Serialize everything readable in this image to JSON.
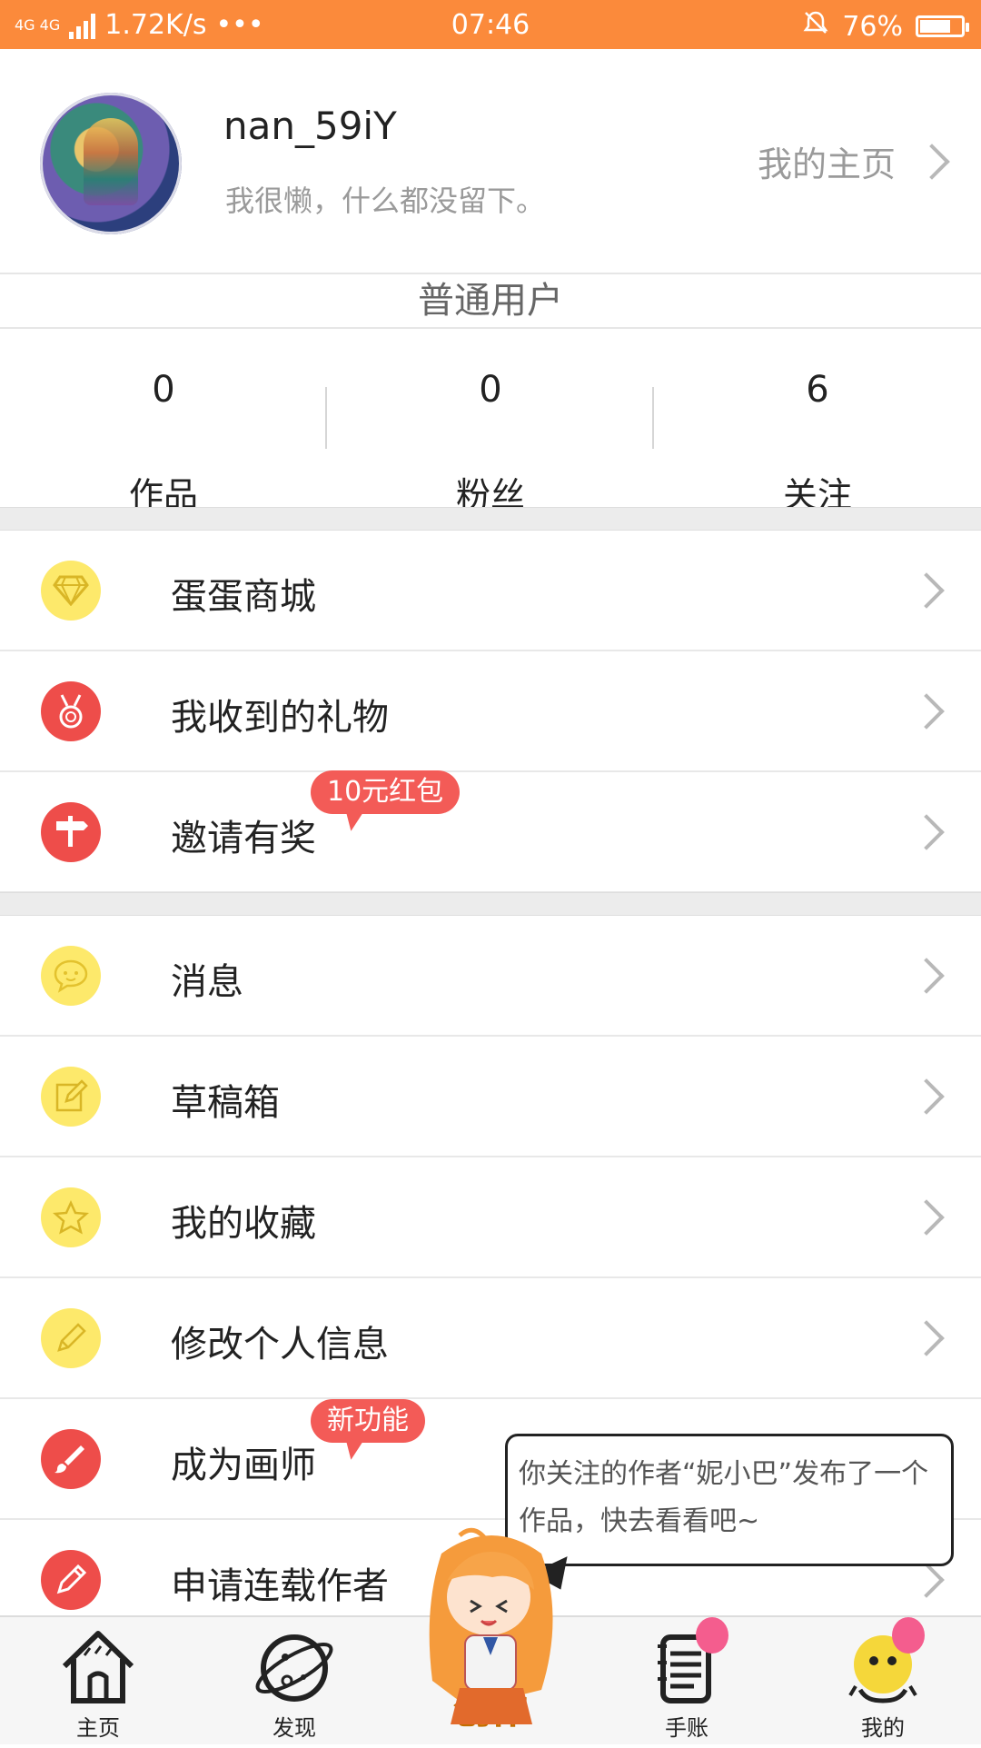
{
  "status_bar": {
    "network": "4G 4G",
    "speed": "1.72K/s",
    "dots": "•••",
    "time": "07:46",
    "battery_text": "76%",
    "battery_level": 0.76
  },
  "profile": {
    "username": "nan_59iY",
    "signature": "我很懒，什么都没留下。",
    "homepage_label": "我的主页",
    "user_level": "普通用户"
  },
  "stats": [
    {
      "value": "0",
      "label": "作品"
    },
    {
      "value": "0",
      "label": "粉丝"
    },
    {
      "value": "6",
      "label": "关注"
    }
  ],
  "menu_group1": [
    {
      "label": "蛋蛋商城",
      "icon": "diamond-icon",
      "color": "yellow"
    },
    {
      "label": "我收到的礼物",
      "icon": "medal-icon",
      "color": "red"
    },
    {
      "label": "邀请有奖",
      "icon": "signpost-icon",
      "color": "red",
      "badge": "10元红包"
    }
  ],
  "menu_group2": [
    {
      "label": "消息",
      "icon": "chat-face-icon",
      "color": "yellow"
    },
    {
      "label": "草稿箱",
      "icon": "edit-icon",
      "color": "yellow"
    },
    {
      "label": "我的收藏",
      "icon": "star-icon",
      "color": "yellow"
    },
    {
      "label": "修改个人信息",
      "icon": "pencil-icon",
      "color": "yellow"
    },
    {
      "label": "成为画师",
      "icon": "brush-icon",
      "color": "red",
      "badge": "新功能"
    },
    {
      "label": "申请连载作者",
      "icon": "pen-icon",
      "color": "red"
    }
  ],
  "notification": {
    "text": "你关注的作者“妮小巴”发布了一个作品，快去看看吧~"
  },
  "tabs": [
    {
      "label": "主页",
      "icon": "house-icon"
    },
    {
      "label": "发现",
      "icon": "planet-icon"
    },
    {
      "label": "创作",
      "icon": "create-icon"
    },
    {
      "label": "手账",
      "icon": "notebook-icon",
      "badge": "!"
    },
    {
      "label": "我的",
      "icon": "profile-mascot-icon",
      "badge": "!"
    }
  ],
  "colors": {
    "status_bar": "#fb8a3b",
    "yellow_icon": "#fde96b",
    "red_icon": "#ee4d4a",
    "badge": "#f35b57",
    "create_label": "#f7a21b"
  }
}
